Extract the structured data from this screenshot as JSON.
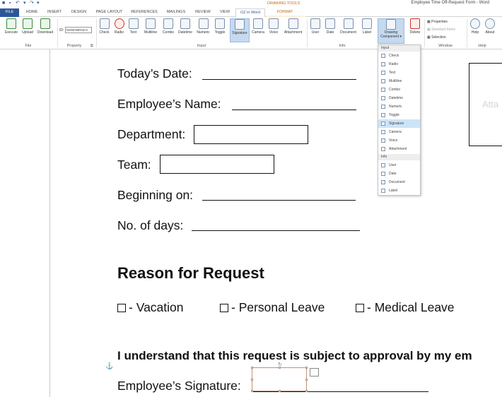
{
  "window": {
    "title": "Employee Time Off-Request Form - Word",
    "contextual_group": "DRAWING TOOLS"
  },
  "tabs": [
    {
      "label": "FILE"
    },
    {
      "label": "HOME"
    },
    {
      "label": "INSERT"
    },
    {
      "label": "DESIGN"
    },
    {
      "label": "PAGE LAYOUT"
    },
    {
      "label": "REFERENCES"
    },
    {
      "label": "MAILINGS"
    },
    {
      "label": "REVIEW"
    },
    {
      "label": "VIEW"
    },
    {
      "label": "OZ in Word"
    },
    {
      "label": "FORMAT"
    }
  ],
  "ribbon": {
    "file_group": {
      "label": "File",
      "buttons": [
        "Execute",
        "Upload",
        "Download"
      ]
    },
    "property_group": {
      "label": "Property",
      "id_label": "ID:",
      "id_value": "OZSIGNPAD 0"
    },
    "input_group": {
      "label": "Input",
      "buttons": [
        "Check",
        "Radio",
        "Text",
        "Multiline",
        "Combo",
        "Datetime",
        "Numeric",
        "Toggle",
        "Signature",
        "Camera",
        "Voice",
        "Attachment"
      ]
    },
    "info_group": {
      "label": "Info",
      "buttons": [
        "User",
        "Date",
        "Document",
        "Label"
      ]
    },
    "drawing_button": {
      "label_line1": "Drawing",
      "label_line2": "Component ▾"
    },
    "delete_button": {
      "label": "Delete"
    },
    "window_group": {
      "label": "Window",
      "items": [
        "Properties",
        "Standard Items",
        "Selection"
      ]
    },
    "help_group": {
      "label": "Help",
      "buttons": [
        "Help",
        "About"
      ]
    }
  },
  "dropdown": {
    "input_header": "Input",
    "input_items": [
      "Check",
      "Radio",
      "Text",
      "Multiline",
      "Combo",
      "Datetime",
      "Numeric",
      "Toggle",
      "Signature",
      "Camera",
      "Voice",
      "Attachment"
    ],
    "highlighted": "Signature",
    "info_header": "Info",
    "info_items": [
      "User",
      "Date",
      "Document",
      "Label"
    ]
  },
  "document": {
    "todays_date": "Today’s Date:",
    "employee_name": "Employee’s Name:",
    "department": "Department:",
    "team": "Team:",
    "beginning_on": "Beginning on:",
    "no_of_days": "No. of days:",
    "reason_heading": "Reason for Request",
    "vacation": "- Vacation",
    "personal_leave": "- Personal Leave",
    "medical_leave": "- Medical Leave",
    "understand": "I understand that this request is subject to approval by my em",
    "employee_signature": "Employee’s Signature:",
    "attach_placeholder": "Atta"
  }
}
